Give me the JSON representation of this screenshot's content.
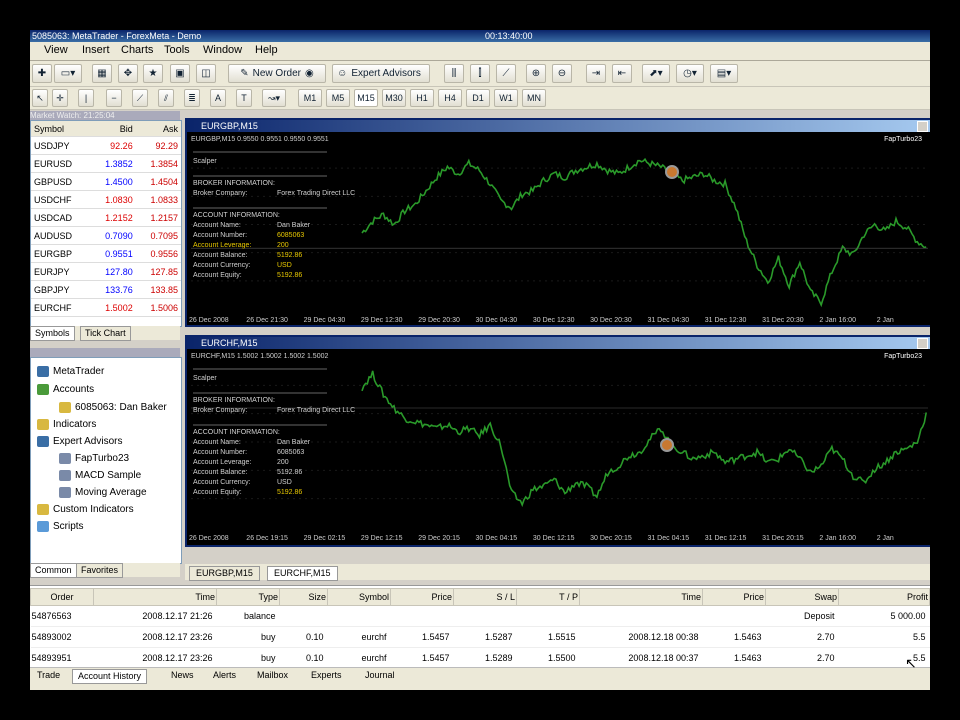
{
  "titlebar": {
    "title": "5085063: MetaTrader - ForexMeta - Demo",
    "clock": "00:13:40:00"
  },
  "menu": [
    "View",
    "Insert",
    "Charts",
    "Tools",
    "Window",
    "Help"
  ],
  "toolbar": {
    "new_order": "New Order",
    "expert_advisors": "Expert Advisors"
  },
  "timeframes": [
    "M1",
    "M5",
    "M15",
    "M30",
    "H1",
    "H4",
    "D1",
    "W1",
    "MN"
  ],
  "market_watch": {
    "title": "Market Watch: 21:25:04",
    "columns": [
      "Symbol",
      "Bid",
      "Ask"
    ],
    "rows": [
      {
        "symbol": "USDJPY",
        "bid": "92.26",
        "ask": "92.29"
      },
      {
        "symbol": "EURUSD",
        "bid": "1.3852",
        "ask": "1.3854"
      },
      {
        "symbol": "GBPUSD",
        "bid": "1.4500",
        "ask": "1.4504"
      },
      {
        "symbol": "USDCHF",
        "bid": "1.0830",
        "ask": "1.0833"
      },
      {
        "symbol": "USDCAD",
        "bid": "1.2152",
        "ask": "1.2157"
      },
      {
        "symbol": "AUDUSD",
        "bid": "0.7090",
        "ask": "0.7095"
      },
      {
        "symbol": "EURGBP",
        "bid": "0.9551",
        "ask": "0.9556"
      },
      {
        "symbol": "EURJPY",
        "bid": "127.80",
        "ask": "127.85"
      },
      {
        "symbol": "GBPJPY",
        "bid": "133.76",
        "ask": "133.85"
      },
      {
        "symbol": "EURCHF",
        "bid": "1.5002",
        "ask": "1.5006"
      }
    ],
    "tabs": [
      "Symbols",
      "Tick Chart"
    ]
  },
  "navigator": {
    "title": "Navigator",
    "items": {
      "root": "MetaTrader",
      "accounts": "Accounts",
      "account": "6085063: Dan Baker",
      "indicators": "Indicators",
      "experts": "Expert Advisors",
      "ea1": "FapTurbo23",
      "ea2": "MACD Sample",
      "ea3": "Moving Average",
      "custom": "Custom Indicators",
      "scripts": "Scripts"
    },
    "tabs": [
      "Common",
      "Favorites"
    ]
  },
  "charts": [
    {
      "window_title": "EURGBP,M15",
      "header": "EURGBP,M15  0.9550 0.9551 0.9550 0.9551",
      "ea_name": "FapTurbo23",
      "dates": [
        "26 Dec 2008",
        "26 Dec 21:30",
        "29 Dec 04:30",
        "29 Dec 12:30",
        "29 Dec 20:30",
        "30 Dec 04:30",
        "30 Dec 12:30",
        "30 Dec 20:30",
        "31 Dec 04:30",
        "31 Dec 12:30",
        "31 Dec 20:30",
        "2 Jan 16:00",
        "2 Jan"
      ],
      "series": [
        0.45,
        0.52,
        0.56,
        0.5,
        0.58,
        0.62,
        0.7,
        0.78,
        0.84,
        0.8,
        0.86,
        0.82,
        0.74,
        0.64,
        0.6,
        0.68,
        0.7,
        0.76,
        0.8,
        0.78,
        0.82,
        0.84,
        0.86,
        0.82,
        0.8,
        0.84,
        0.88,
        0.86,
        0.84,
        0.8,
        0.76,
        0.78,
        0.8,
        0.76,
        0.74,
        0.6,
        0.4,
        0.26,
        0.16,
        0.3,
        0.14,
        0.28,
        0.1,
        0.04,
        0.22,
        0.36,
        0.32,
        0.44,
        0.5,
        0.46,
        0.52,
        0.48,
        0.4,
        0.36
      ]
    },
    {
      "window_title": "EURCHF,M15",
      "header": "EURCHF,M15  1.5002 1.5002 1.5002 1.5002",
      "ea_name": "FapTurbo23",
      "dates": [
        "26 Dec 2008",
        "26 Dec 19:15",
        "29 Dec 02:15",
        "29 Dec 12:15",
        "29 Dec 20:15",
        "30 Dec 04:15",
        "30 Dec 12:15",
        "30 Dec 20:15",
        "31 Dec 04:15",
        "31 Dec 12:15",
        "31 Dec 20:15",
        "2 Jan 16:00",
        "2 Jan"
      ],
      "series": [
        0.82,
        0.9,
        0.78,
        0.7,
        0.64,
        0.62,
        0.6,
        0.58,
        0.6,
        0.56,
        0.58,
        0.54,
        0.6,
        0.48,
        0.2,
        0.14,
        0.22,
        0.24,
        0.28,
        0.2,
        0.26,
        0.24,
        0.18,
        0.32,
        0.36,
        0.42,
        0.44,
        0.52,
        0.58,
        0.48,
        0.44,
        0.4,
        0.42,
        0.44,
        0.38,
        0.4,
        0.42,
        0.44,
        0.38,
        0.4,
        0.46,
        0.4,
        0.32,
        0.36,
        0.46,
        0.4,
        0.3,
        0.26,
        0.34,
        0.38,
        0.44,
        0.46,
        0.5,
        0.7
      ]
    }
  ],
  "account_info": {
    "scalper": "Scalper",
    "broker_info": "BROKER INFORMATION:",
    "broker_company_label": "Broker Company:",
    "broker_company": "Forex Trading Direct LLC",
    "account_info": "ACCOUNT INFORMATION:",
    "name_label": "Account Name:",
    "name": "Dan Baker",
    "number_label": "Account Number:",
    "number": "6085063",
    "leverage_label": "Account Leverage:",
    "leverage": "200",
    "balance_label": "Account Balance:",
    "balance": "5192.86",
    "currency_label": "Account Currency:",
    "currency": "USD",
    "equity_label": "Account Equity:",
    "equity": "5192.86"
  },
  "chart_tabs": [
    "EURGBP,M15",
    "EURCHF,M15"
  ],
  "terminal": {
    "columns": [
      "Order",
      "Time",
      "Type",
      "Size",
      "Symbol",
      "Price",
      "S / L",
      "T / P",
      "Time",
      "Price",
      "Swap",
      "Profit"
    ],
    "rows": [
      [
        "54876563",
        "2008.12.17 21:26",
        "balance",
        "",
        "",
        "",
        "",
        "",
        "",
        "",
        "Deposit",
        "5 000.00"
      ],
      [
        "54893002",
        "2008.12.17 23:26",
        "buy",
        "0.10",
        "eurchf",
        "1.5457",
        "1.5287",
        "1.5515",
        "2008.12.18 00:38",
        "1.5463",
        "2.70",
        "5.5"
      ],
      [
        "54893951",
        "2008.12.17 23:26",
        "buy",
        "0.10",
        "eurchf",
        "1.5457",
        "1.5289",
        "1.5500",
        "2008.12.18 00:37",
        "1.5463",
        "2.70",
        "5.5"
      ]
    ],
    "tabs": [
      "Trade",
      "Account History",
      "News",
      "Alerts",
      "Mailbox",
      "Experts",
      "Journal"
    ]
  },
  "colors": {
    "line": "#2a9a2a",
    "chart_bg": "#000000",
    "accent": "#0a246a"
  }
}
